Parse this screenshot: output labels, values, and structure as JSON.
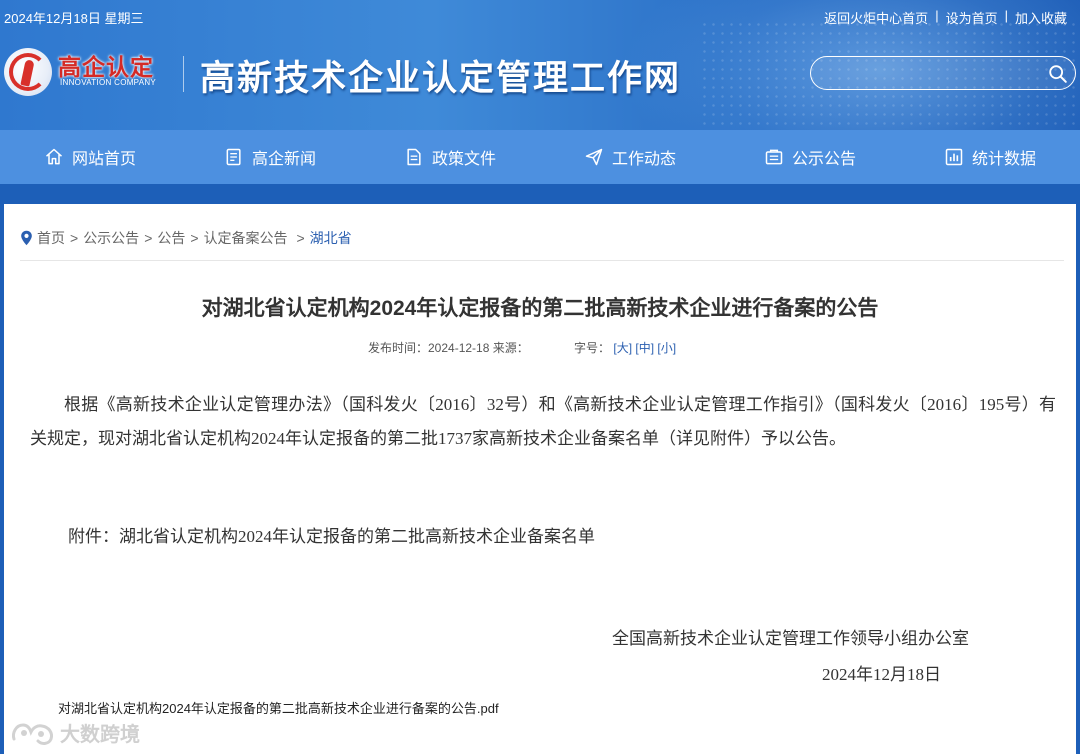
{
  "topbar": {
    "date": "2024年12月18日 星期三",
    "links": [
      "返回火炬中心首页",
      "设为首页",
      "加入收藏"
    ]
  },
  "logo": {
    "name": "高企认定",
    "sub": "INNOVATION COMPANY"
  },
  "site_title": "高新技术企业认定管理工作网",
  "search": {
    "placeholder": "",
    "value": ""
  },
  "nav": [
    {
      "label": "网站首页",
      "icon": "home-icon"
    },
    {
      "label": "高企新闻",
      "icon": "news-icon"
    },
    {
      "label": "政策文件",
      "icon": "document-icon"
    },
    {
      "label": "工作动态",
      "icon": "paper-plane-icon"
    },
    {
      "label": "公示公告",
      "icon": "notice-icon"
    },
    {
      "label": "统计数据",
      "icon": "chart-icon"
    }
  ],
  "breadcrumb": {
    "items": [
      "首页",
      "公示公告",
      "公告",
      "认定备案公告"
    ],
    "current": "湖北省"
  },
  "article": {
    "title": "对湖北省认定机构2024年认定报备的第二批高新技术企业进行备案的公告",
    "meta_publish": "发布时间：2024-12-18 来源：",
    "meta_size_label": "字号：",
    "size_options": [
      "[大]",
      "[中]",
      "[小]"
    ],
    "body": "根据《高新技术企业认定管理办法》（国科发火〔2016〕32号）和《高新技术企业认定管理工作指引》（国科发火〔2016〕195号）有关规定，现对湖北省认定机构2024年认定报备的第二批1737家高新技术企业备案名单（详见附件）予以公告。",
    "attachment_line": "附件：湖北省认定机构2024年认定报备的第二批高新技术企业备案名单",
    "signature_org": "全国高新技术企业认定管理工作领导小组办公室",
    "signature_date": "2024年12月18日",
    "pdf_file": "对湖北省认定机构2024年认定报备的第二批高新技术企业进行备案的公告.pdf"
  },
  "watermark": "大数跨境",
  "colors": {
    "header_blue": "#2f78cf",
    "nav_blue": "#4d90e0",
    "link_blue": "#2b5fb0",
    "logo_red": "#d42a26"
  }
}
